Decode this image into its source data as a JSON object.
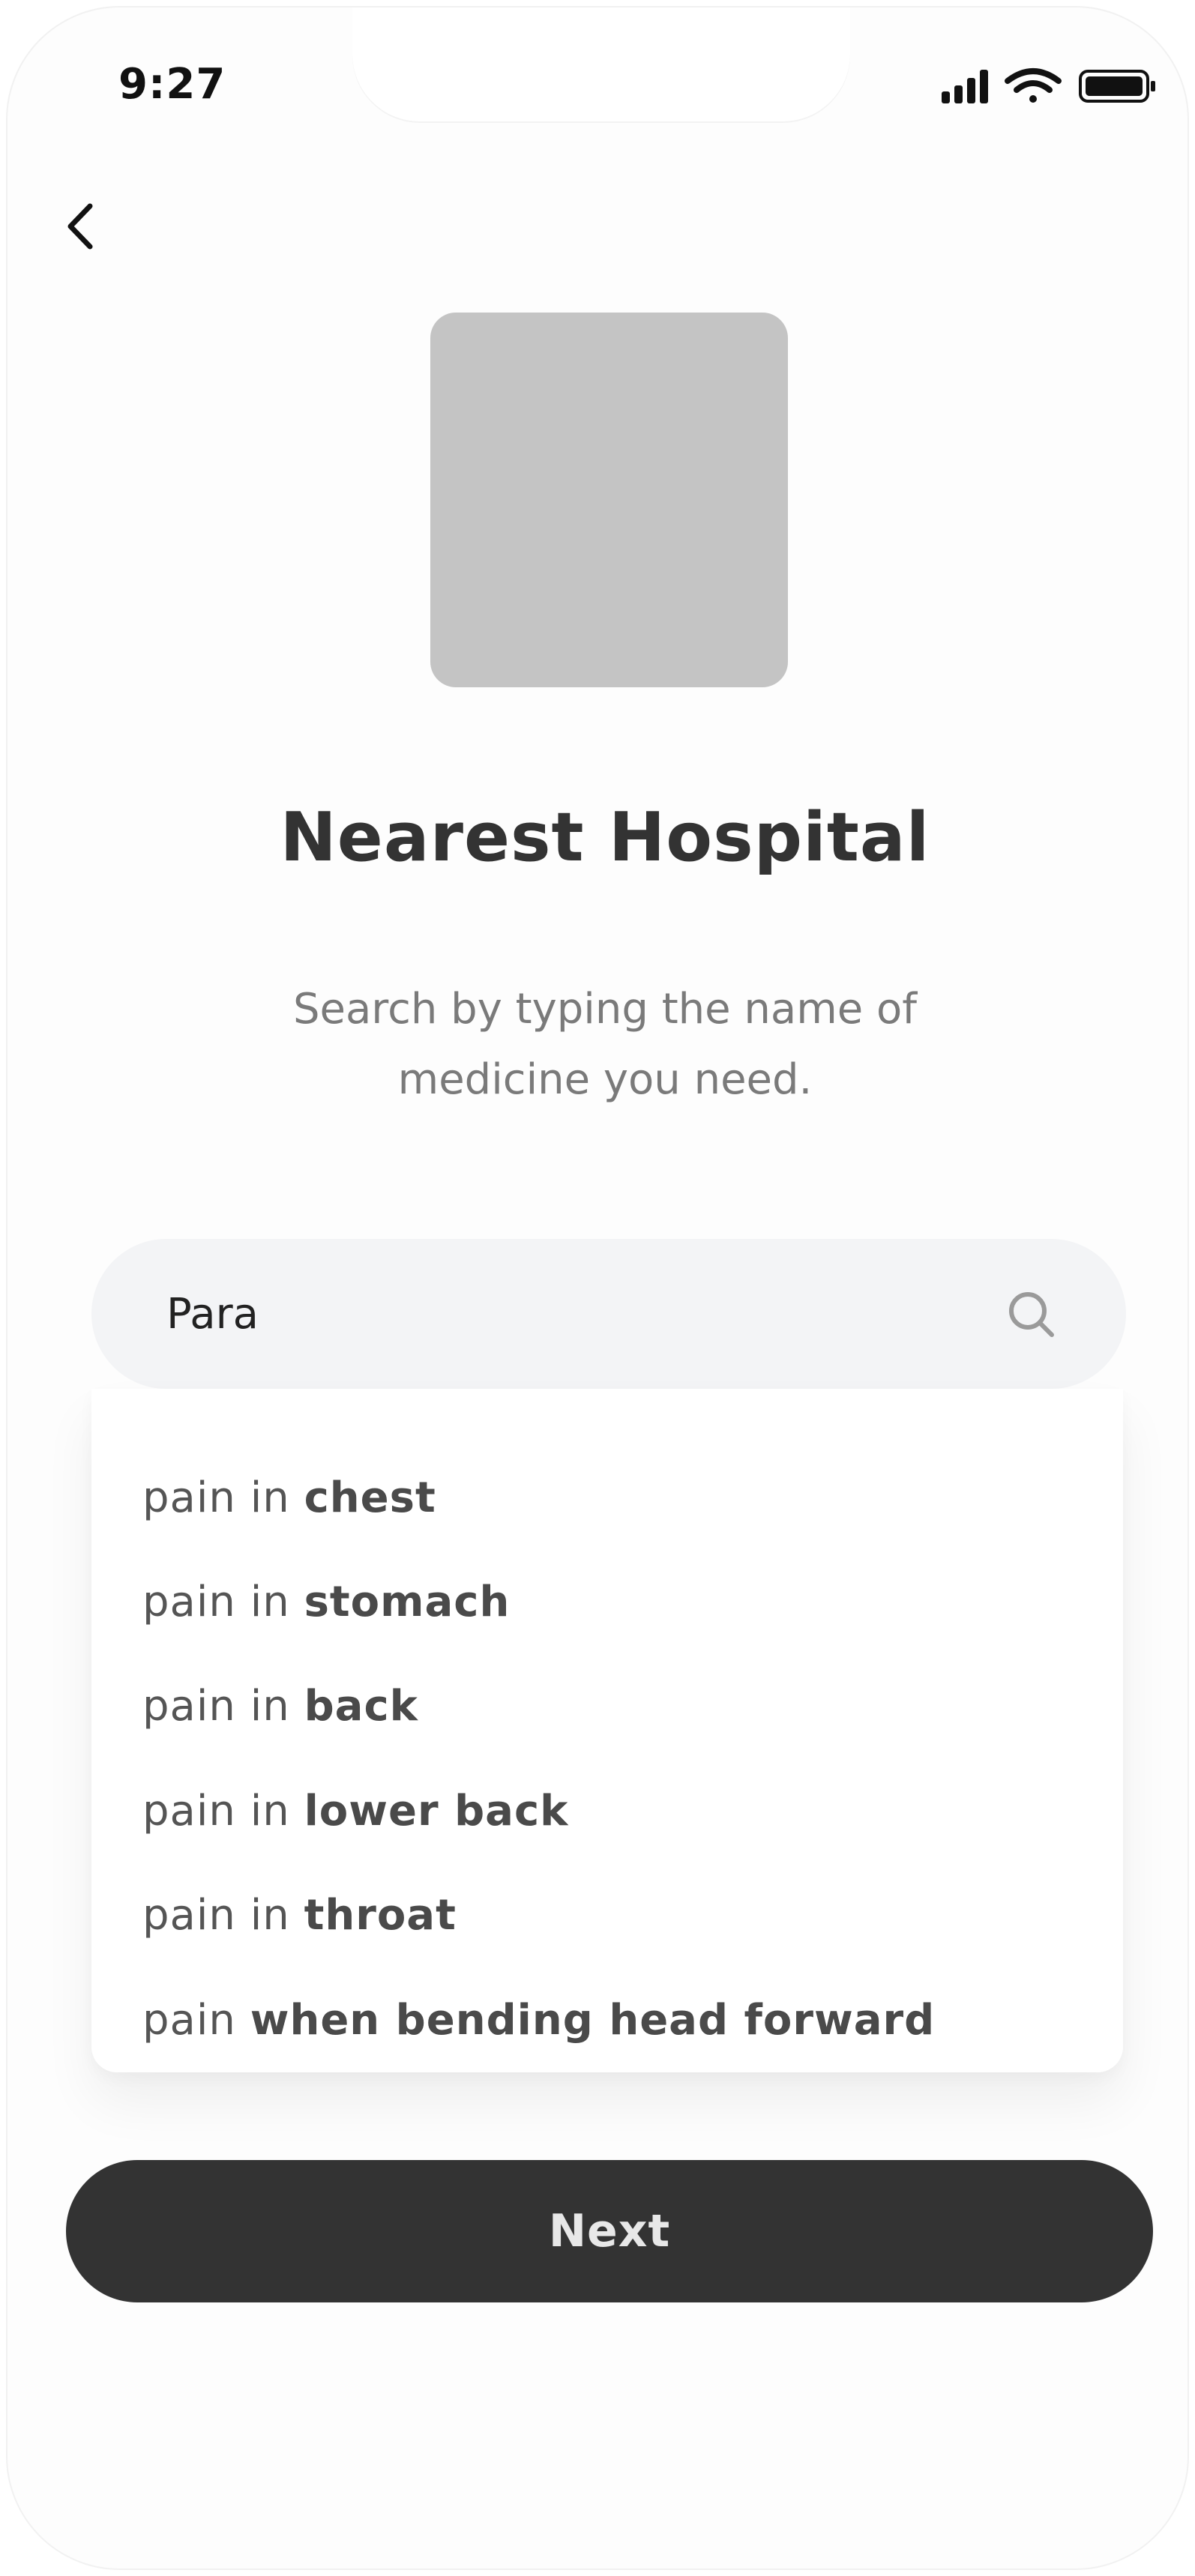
{
  "status_bar": {
    "time": "9:27",
    "icons": [
      "signal-icon",
      "wifi-icon",
      "battery-icon"
    ]
  },
  "nav": {
    "back_icon": "chevron-left-icon"
  },
  "header": {
    "title": "Nearest Hospital",
    "subtitle_line1": "Search by typing the name of",
    "subtitle_line2": "medicine you need."
  },
  "search": {
    "value": "Para",
    "icon": "search-icon"
  },
  "suggestions": [
    {
      "prefix": "pain in ",
      "match": "chest"
    },
    {
      "prefix": "pain in ",
      "match": "stomach"
    },
    {
      "prefix": "pain in ",
      "match": "back"
    },
    {
      "prefix": "pain in ",
      "match": "lower back"
    },
    {
      "prefix": "pain in ",
      "match": "throat"
    },
    {
      "prefix": "pain ",
      "match": "when bending head forward"
    }
  ],
  "actions": {
    "next_label": "Next"
  },
  "colors": {
    "primary": "#333333",
    "input_bg": "#f3f4f6",
    "placeholder_image": "#c4c4c4",
    "muted_text": "#7a7a7a"
  }
}
